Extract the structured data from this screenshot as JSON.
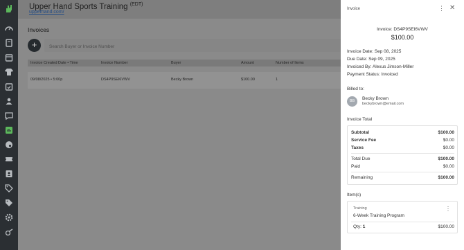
{
  "app": {
    "title": "Upper Hand Sports Training",
    "timezone": "(EDT)",
    "link": "upperhand.com/"
  },
  "sidebar": {
    "icons": [
      "speedometer-icon",
      "book-icon",
      "calendar-icon",
      "jersey-icon",
      "calendar-check-icon",
      "users-icon",
      "chat-icon",
      "reports-icon",
      "palette-icon",
      "ticket-icon",
      "contacts-icon",
      "tag-icon",
      "tags-icon",
      "settings-icon",
      "whistle-icon"
    ]
  },
  "page": {
    "title": "Invoices",
    "add_label": "+",
    "search_placeholder": "Search Buyer or Invoice Number"
  },
  "table": {
    "headers": [
      "Invoice Created Date • Time",
      "Invoice Number",
      "Buyer",
      "Amount",
      "Number of Items"
    ],
    "rows": [
      [
        "09/08/2025 • 5:00p",
        "DS4P9SEI6VWV",
        "Becky Brown",
        "$100.00",
        "1"
      ]
    ]
  },
  "panel": {
    "header": "Invoice",
    "more": "⋮",
    "close": "✕",
    "invoice_number": "Invoice: DS4P9SEI6VWV",
    "amount": "$100.00",
    "invoice_date": "Invoice Date: Sep 08, 2025",
    "due_date": "Due Date: Sep 09, 2025",
    "invoiced_by": "Invoiced By: Alexus Jimson-Miller",
    "payment_status": "Payment Status: Invoiced",
    "billed_to_label": "Billed to:",
    "buyer": {
      "initials": "BB",
      "name": "Becky Brown",
      "email": "beckybrown@email.com"
    },
    "invoice_total_label": "Invoice Total",
    "totals": {
      "subtotal_label": "Subtotal",
      "subtotal": "$100.00",
      "service_fee_label": "Service Fee",
      "service_fee": "$0.00",
      "taxes_label": "Taxes",
      "taxes": "$0.00",
      "total_due_label": "Total Due",
      "total_due": "$100.00",
      "paid_label": "Paid",
      "paid": "$0.00",
      "remaining_label": "Remaining",
      "remaining": "$100.00"
    },
    "items_label": "Item(s)",
    "item": {
      "type": "Training",
      "name": "6-Week Training Program",
      "more": "⋮",
      "qty_label": "Qty:",
      "qty": "1",
      "price": "$100.00"
    }
  },
  "colors": {
    "sidebar_bg": "#2b2f33",
    "accent_green": "#5cb85c",
    "overlay_gray": "#8a8a8a",
    "panel_bg": "#ffffff"
  }
}
